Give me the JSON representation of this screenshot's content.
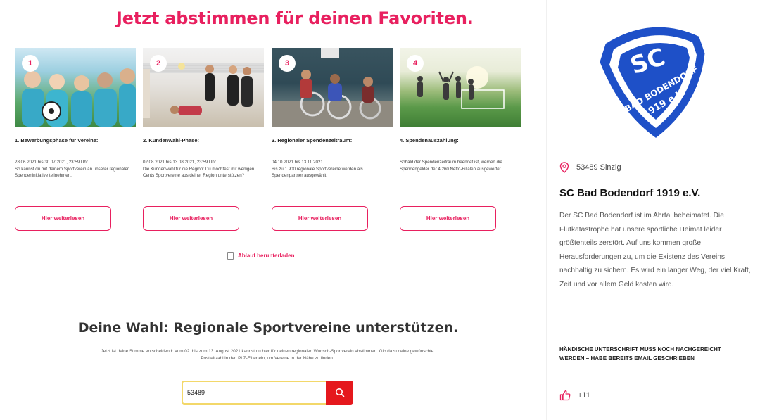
{
  "header": {
    "title": "Jetzt abstimmen für deinen Favoriten."
  },
  "steps": [
    {
      "number": "1",
      "title": "1. Bewerbungsphase für Vereine:",
      "text": "28.06.2021 bis 30.07.2021, 23:59 Uhr\nSo kannst du mit deinem Sportverein an unserer regionalen Spendeninitiative teilnehmen.",
      "button": "Hier weiterlesen"
    },
    {
      "number": "2",
      "title": "2. Kundenwahl-Phase:",
      "text": "02.08.2021 bis 13.08.2021, 23:59 Uhr\nDie Kundenwahl für die Region: Du möchtest mit wenigen Cents Sportvereine aus deiner Region unterstützen?",
      "button": "Hier weiterlesen"
    },
    {
      "number": "3",
      "title": "3. Regionaler Spendenzeitraum:",
      "text": "04.10.2021 bis 13.11.2021\nBis zu 1.900 regionale Sportvereine werden als Spendenpartner ausgewählt.",
      "button": "Hier weiterlesen"
    },
    {
      "number": "4",
      "title": "4. Spendenauszahlung:",
      "text": "Sobald der Spendenzeitraum beendet ist, werden die Spendengelder der 4.260 Netto-Filialen ausgewertet.",
      "button": "Hier weiterlesen"
    }
  ],
  "download": {
    "label": "Ablauf herunterladen"
  },
  "vote_section": {
    "title": "Deine Wahl: Regionale Sportvereine unterstützen.",
    "text": "Jetzt ist deine Stimme entscheidend: Vom 02. bis zum 13. August 2021 kannst du hier für deinen regionalen Wunsch-Sportverein abstimmen. Gib dazu deine gewünschte Postleitzahl in den PLZ-Filter ein, um Vereine in der Nähe zu finden."
  },
  "search": {
    "value": "53489"
  },
  "club": {
    "crest_text_top": "SC",
    "crest_text_mid": "BAD BODENDORF",
    "crest_text_bottom": "1919 e.V.",
    "location": "53489 Sinzig",
    "name": "SC Bad Bodendorf 1919 e.V.",
    "description": "Der SC Bad Bodendorf ist im Ahrtal beheimatet. Die Flutkatastrophe hat unsere sportliche Heimat leider größtenteils zerstört. Auf uns kommen große Herausforderungen zu, um die Existenz des Vereins nachhaltig zu sichern. Es wird ein langer Weg, der viel Kraft, Zeit und vor allem Geld kosten wird.",
    "note": "Händische Unterschrift muss noch nachgereicht werden – habe bereits Email geschrieben",
    "likes": "+11"
  },
  "colors": {
    "accent": "#e8205f",
    "search_button": "#e5181d",
    "crest_blue": "#1e50c8"
  }
}
